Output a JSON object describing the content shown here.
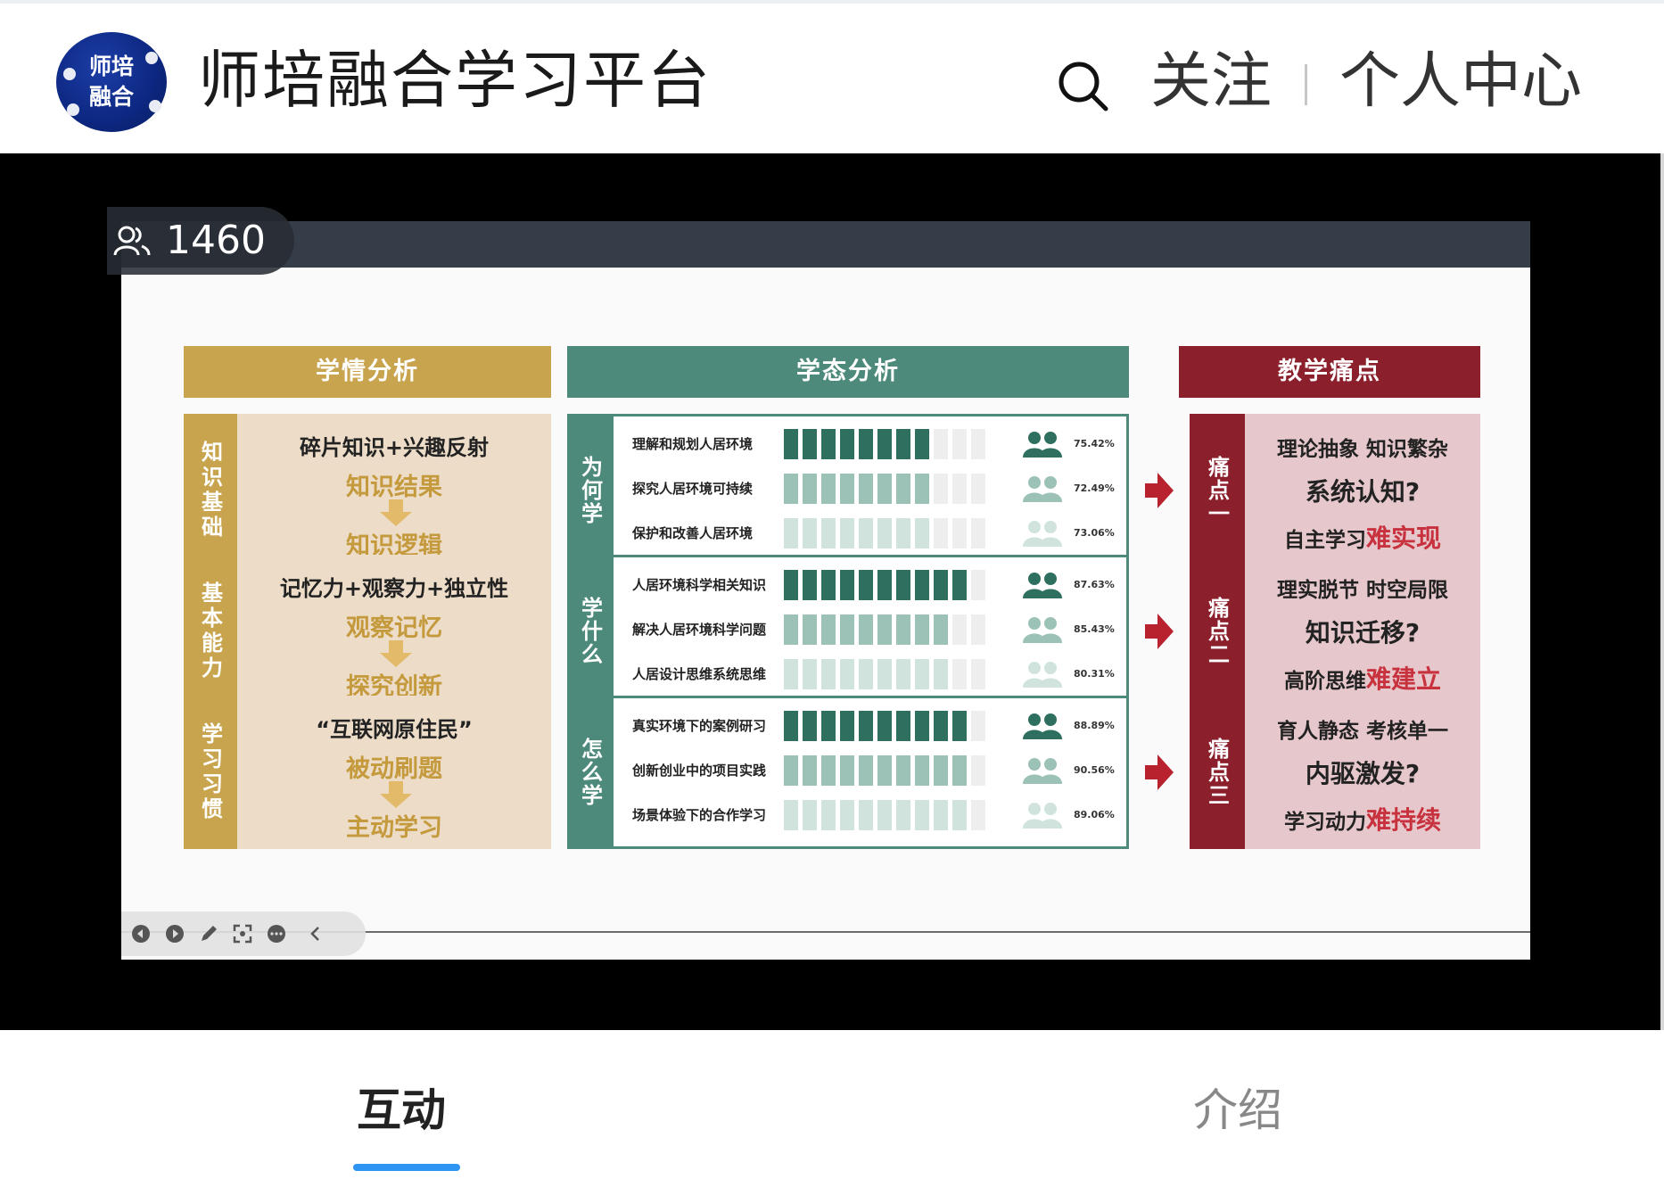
{
  "header": {
    "logo_text_1": "师培",
    "logo_text_2": "融合",
    "app_title": "师培融合学习平台",
    "follow_label": "关注",
    "profile_label": "个人中心"
  },
  "player": {
    "viewer_count": "1460"
  },
  "slide": {
    "col_headers": {
      "analysis": "学情分析",
      "state": "学态分析",
      "pain": "教学痛点"
    },
    "analysis": [
      {
        "side": "知识基础",
        "line1": "碎片知识+兴趣反射",
        "line2": "知识结果",
        "line3": "知识逻辑"
      },
      {
        "side": "基本能力",
        "line1": "记忆力+观察力+独立性",
        "line2": "观察记忆",
        "line3": "探究创新"
      },
      {
        "side": "学习习惯",
        "line1": "“互联网原住民”",
        "line2": "被动刷题",
        "line3": "主动学习"
      }
    ],
    "state": [
      {
        "side": "为何学",
        "items": [
          {
            "label": "理解和规划人居环境",
            "pct": "75.42%",
            "value": 75.42
          },
          {
            "label": "探究人居环境可持续",
            "pct": "72.49%",
            "value": 72.49
          },
          {
            "label": "保护和改善人居环境",
            "pct": "73.06%",
            "value": 73.06
          }
        ]
      },
      {
        "side": "学什么",
        "items": [
          {
            "label": "人居环境科学相关知识",
            "pct": "87.63%",
            "value": 87.63
          },
          {
            "label": "解决人居环境科学问题",
            "pct": "85.43%",
            "value": 85.43
          },
          {
            "label": "人居设计思维系统思维",
            "pct": "80.31%",
            "value": 80.31
          }
        ]
      },
      {
        "side": "怎么学",
        "items": [
          {
            "label": "真实环境下的案例研习",
            "pct": "88.89%",
            "value": 88.89
          },
          {
            "label": "创新创业中的项目实践",
            "pct": "90.56%",
            "value": 90.56
          },
          {
            "label": "场景体验下的合作学习",
            "pct": "89.06%",
            "value": 89.06
          }
        ]
      }
    ],
    "pain": [
      {
        "side": "痛点一",
        "line1": "理论抽象 知识繁杂",
        "line2": "系统认知?",
        "line3a": "自主学习",
        "line3b": "难实现"
      },
      {
        "side": "痛点二",
        "line1": "理实脱节 时空局限",
        "line2": "知识迁移?",
        "line3a": "高阶思维",
        "line3b": "难建立"
      },
      {
        "side": "痛点三",
        "line1": "育人静态 考核单一",
        "line2": "内驱激发?",
        "line3a": "学习动力",
        "line3b": "难持续"
      }
    ]
  },
  "tabs": {
    "interaction": "互动",
    "intro": "介绍"
  },
  "colors": {
    "gold": "#c9a44e",
    "teal": "#4e8a7c",
    "maroon": "#8b1f2c",
    "tab_indicator": "#2f95f2"
  }
}
